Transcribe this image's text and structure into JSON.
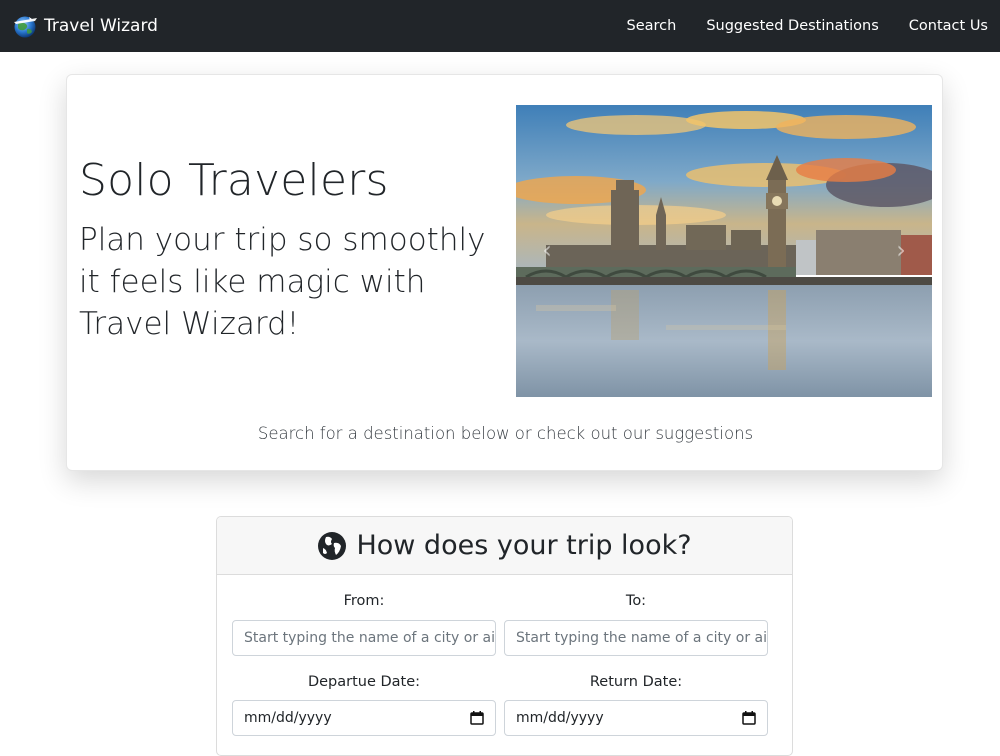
{
  "navbar": {
    "brand": "Travel Wizard",
    "brand_logo_icon": "globe-airplane-logo-icon",
    "links": [
      "Search",
      "Suggested Destinations",
      "Contact Us"
    ]
  },
  "hero": {
    "title": "Solo Travelers",
    "subtitle": "Plan your trip so smoothly it feels like magic with Travel Wizard!",
    "image_icon": "london-westminster-photo",
    "prev_icon": "chevron-left-icon",
    "next_icon": "chevron-right-icon",
    "caption": "Search for a destination below or check out our suggestions"
  },
  "form": {
    "title": "How does your trip look?",
    "title_icon": "globe-icon",
    "from_label": "From:",
    "to_label": "To:",
    "from_placeholder": "Start typing the name of a city or air",
    "to_placeholder": "Start typing the name of a city or air",
    "depart_label": "Departue Date:",
    "return_label": "Return Date:",
    "depart_value": "mm/dd/yyyy",
    "return_value": "mm/dd/yyyy",
    "calendar_icon": "calendar-icon"
  },
  "colors": {
    "navbar_bg": "#212529",
    "text": "#212529"
  }
}
